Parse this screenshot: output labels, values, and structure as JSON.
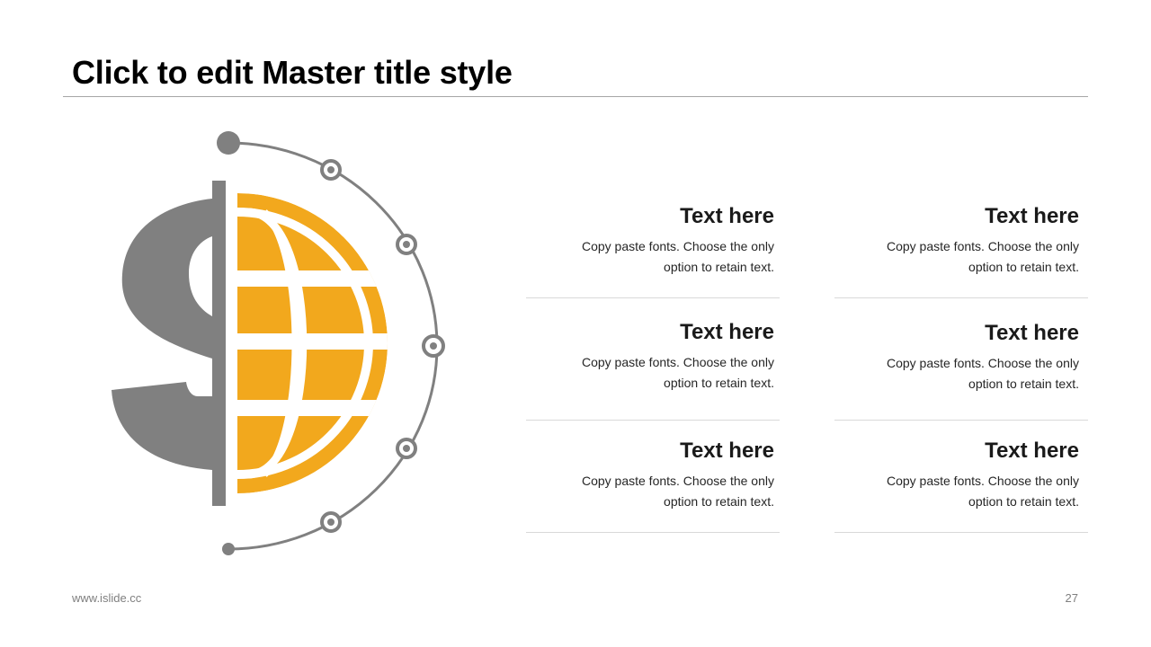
{
  "slide": {
    "title": "Click to edit Master title style"
  },
  "items": [
    {
      "heading": "Text here",
      "body_line1": "Copy paste fonts. Choose the only",
      "body_line2": "option to retain text."
    },
    {
      "heading": "Text here",
      "body_line1": "Copy paste fonts. Choose the only",
      "body_line2": "option to retain text."
    },
    {
      "heading": "Text here",
      "body_line1": "Copy paste fonts. Choose the only",
      "body_line2": "option to retain text."
    },
    {
      "heading": "Text here",
      "body_line1": "Copy paste fonts. Choose the only",
      "body_line2": "option to retain text."
    },
    {
      "heading": "Text here",
      "body_line1": "Copy paste fonts. Choose the only",
      "body_line2": "option to retain text."
    },
    {
      "heading": "Text here",
      "body_line1": "Copy paste fonts. Choose the only",
      "body_line2": "option to retain text."
    }
  ],
  "footer": {
    "url": "www.islide.cc",
    "page_number": "27"
  },
  "colors": {
    "accent": "#F2A81D",
    "gray": "#808080",
    "rule": "#D9D9D9"
  },
  "graphic": {
    "icon": "dollar-globe-icon"
  }
}
